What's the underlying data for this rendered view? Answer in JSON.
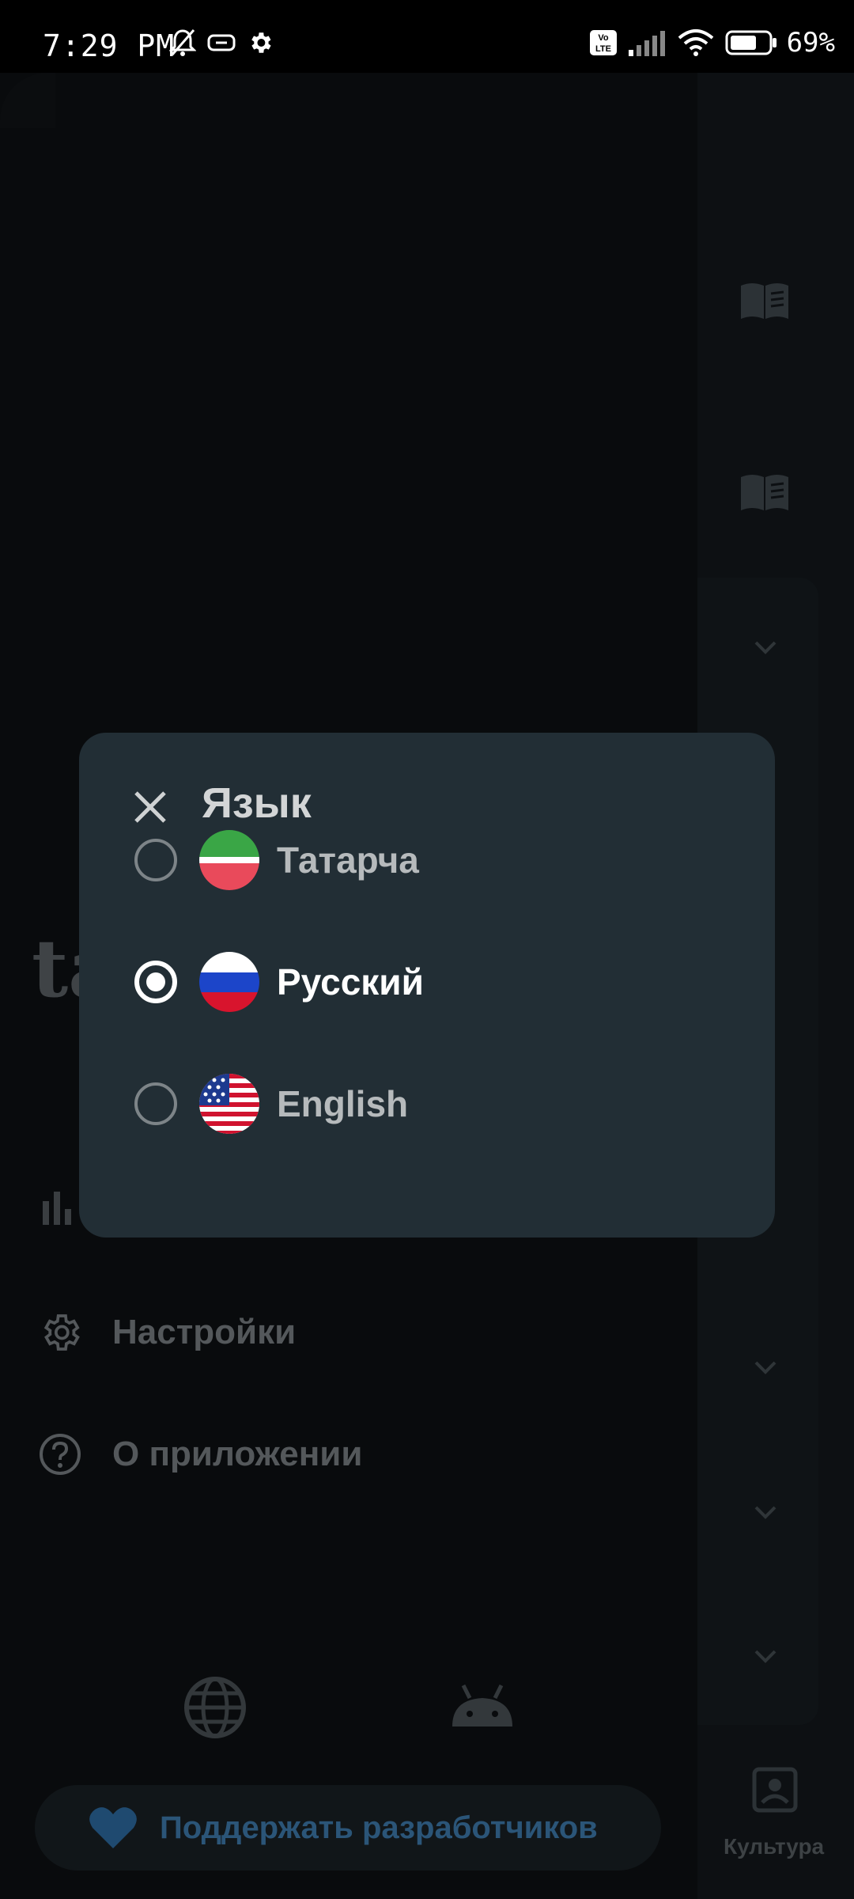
{
  "status_bar": {
    "time": "7:29 PM",
    "battery": "69%",
    "icons": [
      "bell-off-icon",
      "nfc-icon",
      "gear-icon",
      "volte-icon",
      "signal-icon",
      "wifi-icon",
      "battery-icon"
    ]
  },
  "drawer": {
    "logo_partial": "ta",
    "menu": [
      {
        "icon": "stats-icon",
        "label": ""
      },
      {
        "icon": "gear-icon",
        "label": "Настройки"
      },
      {
        "icon": "help-icon",
        "label": "О приложении"
      }
    ],
    "bottom_icons": [
      "globe-icon",
      "android-icon"
    ],
    "support_label": "Поддержать разработчиков"
  },
  "main": {
    "culture_label": "Культура"
  },
  "dialog": {
    "title": "Язык",
    "options": [
      {
        "label": "Татарча",
        "flag": "tatarstan",
        "selected": false
      },
      {
        "label": "Русский",
        "flag": "russia",
        "selected": true
      },
      {
        "label": "English",
        "flag": "usa",
        "selected": false
      }
    ]
  },
  "colors": {
    "dialog_bg": "#222e35",
    "drawer_bg": "#090b0d",
    "support_text": "#2b5578"
  }
}
